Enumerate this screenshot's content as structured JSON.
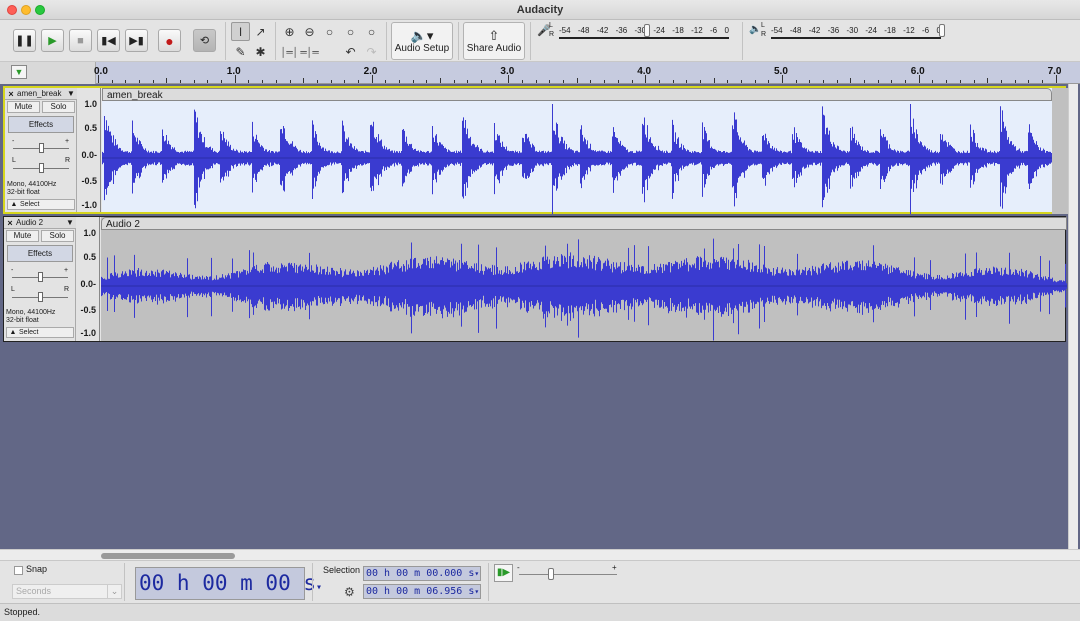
{
  "window": {
    "title": "Audacity"
  },
  "toolbar": {
    "audio_setup_label": "Audio Setup",
    "share_audio_label": "Share Audio",
    "record_meter": {
      "lr": "L\nR",
      "scale": [
        "-54",
        "-48",
        "-42",
        "-36",
        "-30",
        "-24",
        "-18",
        "-12",
        "-6",
        "0"
      ]
    },
    "play_meter": {
      "lr": "L\nR",
      "scale": [
        "-54",
        "-48",
        "-42",
        "-36",
        "-30",
        "-24",
        "-18",
        "-12",
        "-6",
        "0"
      ]
    }
  },
  "ruler": {
    "ticks": [
      "0.0",
      "1.0",
      "2.0",
      "3.0",
      "4.0",
      "5.0",
      "6.0",
      "7.0"
    ]
  },
  "tracks": [
    {
      "name": "amen_break",
      "clip_name": "amen_break",
      "mute_label": "Mute",
      "solo_label": "Solo",
      "effects_label": "Effects",
      "gain_minus": "-",
      "gain_plus": "+",
      "pan_left": "L",
      "pan_right": "R",
      "info_line1": "Mono, 44100Hz",
      "info_line2": "32-bit float",
      "select_label": "Select",
      "scale": [
        "1.0",
        "0.5",
        "0.0-",
        "-0.5",
        "-1.0"
      ]
    },
    {
      "name": "Audio 2",
      "clip_name": "Audio 2",
      "mute_label": "Mute",
      "solo_label": "Solo",
      "effects_label": "Effects",
      "gain_minus": "-",
      "gain_plus": "+",
      "pan_left": "L",
      "pan_right": "R",
      "info_line1": "Mono, 44100Hz",
      "info_line2": "32-bit float",
      "select_label": "Select",
      "scale": [
        "1.0",
        "0.5",
        "0.0-",
        "-0.5",
        "-1.0"
      ]
    }
  ],
  "bottom": {
    "snap_label": "Snap",
    "units_value": "Seconds",
    "time_display": "00 h 00 m 00 s",
    "selection_label": "Selection",
    "selection_start": "00 h 00 m 00.000 s",
    "selection_end": "00 h 00 m 06.956 s",
    "speed_minus": "-",
    "speed_plus": "+"
  },
  "status": {
    "text": "Stopped."
  },
  "colors": {
    "wave": "#3a3bd0",
    "track_bg_selected": "#e6eefb",
    "track_bg": "#c0c0c0",
    "project_bg": "#626786",
    "selected_border": "#d6d61e"
  }
}
